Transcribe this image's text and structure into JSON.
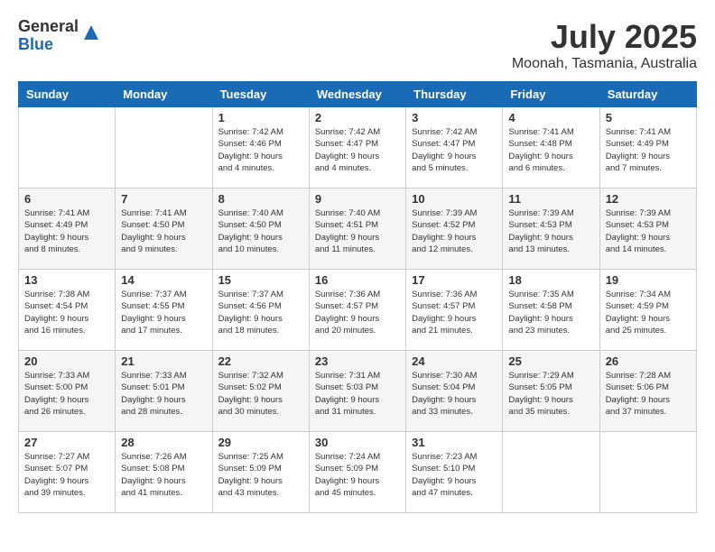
{
  "header": {
    "logo_general": "General",
    "logo_blue": "Blue",
    "month_title": "July 2025",
    "location": "Moonah, Tasmania, Australia"
  },
  "days_of_week": [
    "Sunday",
    "Monday",
    "Tuesday",
    "Wednesday",
    "Thursday",
    "Friday",
    "Saturday"
  ],
  "weeks": [
    [
      {
        "day": "",
        "info": ""
      },
      {
        "day": "",
        "info": ""
      },
      {
        "day": "1",
        "info": "Sunrise: 7:42 AM\nSunset: 4:46 PM\nDaylight: 9 hours\nand 4 minutes."
      },
      {
        "day": "2",
        "info": "Sunrise: 7:42 AM\nSunset: 4:47 PM\nDaylight: 9 hours\nand 4 minutes."
      },
      {
        "day": "3",
        "info": "Sunrise: 7:42 AM\nSunset: 4:47 PM\nDaylight: 9 hours\nand 5 minutes."
      },
      {
        "day": "4",
        "info": "Sunrise: 7:41 AM\nSunset: 4:48 PM\nDaylight: 9 hours\nand 6 minutes."
      },
      {
        "day": "5",
        "info": "Sunrise: 7:41 AM\nSunset: 4:49 PM\nDaylight: 9 hours\nand 7 minutes."
      }
    ],
    [
      {
        "day": "6",
        "info": "Sunrise: 7:41 AM\nSunset: 4:49 PM\nDaylight: 9 hours\nand 8 minutes."
      },
      {
        "day": "7",
        "info": "Sunrise: 7:41 AM\nSunset: 4:50 PM\nDaylight: 9 hours\nand 9 minutes."
      },
      {
        "day": "8",
        "info": "Sunrise: 7:40 AM\nSunset: 4:50 PM\nDaylight: 9 hours\nand 10 minutes."
      },
      {
        "day": "9",
        "info": "Sunrise: 7:40 AM\nSunset: 4:51 PM\nDaylight: 9 hours\nand 11 minutes."
      },
      {
        "day": "10",
        "info": "Sunrise: 7:39 AM\nSunset: 4:52 PM\nDaylight: 9 hours\nand 12 minutes."
      },
      {
        "day": "11",
        "info": "Sunrise: 7:39 AM\nSunset: 4:53 PM\nDaylight: 9 hours\nand 13 minutes."
      },
      {
        "day": "12",
        "info": "Sunrise: 7:39 AM\nSunset: 4:53 PM\nDaylight: 9 hours\nand 14 minutes."
      }
    ],
    [
      {
        "day": "13",
        "info": "Sunrise: 7:38 AM\nSunset: 4:54 PM\nDaylight: 9 hours\nand 16 minutes."
      },
      {
        "day": "14",
        "info": "Sunrise: 7:37 AM\nSunset: 4:55 PM\nDaylight: 9 hours\nand 17 minutes."
      },
      {
        "day": "15",
        "info": "Sunrise: 7:37 AM\nSunset: 4:56 PM\nDaylight: 9 hours\nand 18 minutes."
      },
      {
        "day": "16",
        "info": "Sunrise: 7:36 AM\nSunset: 4:57 PM\nDaylight: 9 hours\nand 20 minutes."
      },
      {
        "day": "17",
        "info": "Sunrise: 7:36 AM\nSunset: 4:57 PM\nDaylight: 9 hours\nand 21 minutes."
      },
      {
        "day": "18",
        "info": "Sunrise: 7:35 AM\nSunset: 4:58 PM\nDaylight: 9 hours\nand 23 minutes."
      },
      {
        "day": "19",
        "info": "Sunrise: 7:34 AM\nSunset: 4:59 PM\nDaylight: 9 hours\nand 25 minutes."
      }
    ],
    [
      {
        "day": "20",
        "info": "Sunrise: 7:33 AM\nSunset: 5:00 PM\nDaylight: 9 hours\nand 26 minutes."
      },
      {
        "day": "21",
        "info": "Sunrise: 7:33 AM\nSunset: 5:01 PM\nDaylight: 9 hours\nand 28 minutes."
      },
      {
        "day": "22",
        "info": "Sunrise: 7:32 AM\nSunset: 5:02 PM\nDaylight: 9 hours\nand 30 minutes."
      },
      {
        "day": "23",
        "info": "Sunrise: 7:31 AM\nSunset: 5:03 PM\nDaylight: 9 hours\nand 31 minutes."
      },
      {
        "day": "24",
        "info": "Sunrise: 7:30 AM\nSunset: 5:04 PM\nDaylight: 9 hours\nand 33 minutes."
      },
      {
        "day": "25",
        "info": "Sunrise: 7:29 AM\nSunset: 5:05 PM\nDaylight: 9 hours\nand 35 minutes."
      },
      {
        "day": "26",
        "info": "Sunrise: 7:28 AM\nSunset: 5:06 PM\nDaylight: 9 hours\nand 37 minutes."
      }
    ],
    [
      {
        "day": "27",
        "info": "Sunrise: 7:27 AM\nSunset: 5:07 PM\nDaylight: 9 hours\nand 39 minutes."
      },
      {
        "day": "28",
        "info": "Sunrise: 7:26 AM\nSunset: 5:08 PM\nDaylight: 9 hours\nand 41 minutes."
      },
      {
        "day": "29",
        "info": "Sunrise: 7:25 AM\nSunset: 5:09 PM\nDaylight: 9 hours\nand 43 minutes."
      },
      {
        "day": "30",
        "info": "Sunrise: 7:24 AM\nSunset: 5:09 PM\nDaylight: 9 hours\nand 45 minutes."
      },
      {
        "day": "31",
        "info": "Sunrise: 7:23 AM\nSunset: 5:10 PM\nDaylight: 9 hours\nand 47 minutes."
      },
      {
        "day": "",
        "info": ""
      },
      {
        "day": "",
        "info": ""
      }
    ]
  ]
}
